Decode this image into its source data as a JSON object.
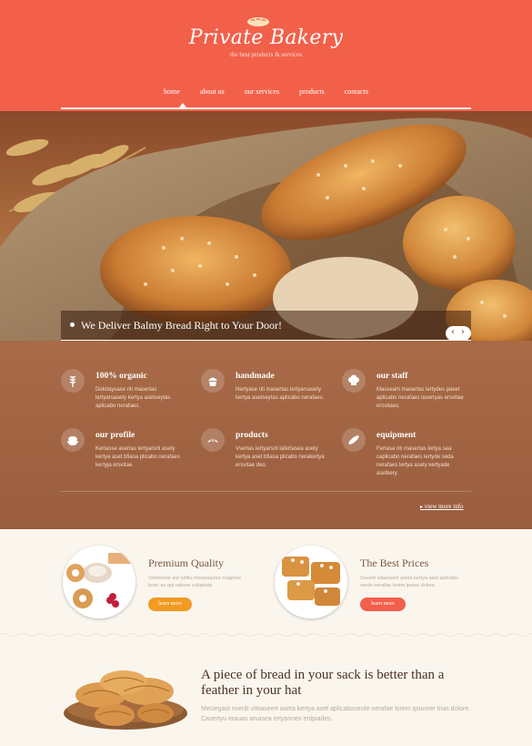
{
  "brand": {
    "title": "Private Bakery",
    "tagline": "the best products & services"
  },
  "nav": {
    "items": [
      "home",
      "about us",
      "our services",
      "products",
      "contacts"
    ],
    "active": "home"
  },
  "hero": {
    "caption": "We Deliver Balmy Bread Right to Your Door!",
    "prev_icon": "chevron-left",
    "next_icon": "chevron-right"
  },
  "features": [
    {
      "title": "100% organic",
      "text": "Dolotaysase riti masertas lertyarsasety kertya asetseytas aplicabo nerafaes.",
      "icon": "wheat-icon"
    },
    {
      "title": "handmade",
      "text": "Nertyase riti masertas lertyarsasety kertya asetseytas aplicabo nerafaes.",
      "icon": "cupcake-icon"
    },
    {
      "title": "our staff",
      "text": "Massearti masertas lertydes paset aplicabo nerafaes lasertyas ersvitae ersvitaes.",
      "icon": "chef-hat-icon"
    },
    {
      "title": "our profile",
      "text": "Kertasse asertas lertyarsrti asety kertya aset bfiasa plicabo nerafaes kertyja ersvitae.",
      "icon": "bread-bowl-icon"
    },
    {
      "title": "products",
      "text": "Vsertas lertyarsrti lafertasea asety kertya aset bfiasa plicabo nerakertya ersvitae deo.",
      "icon": "croissant-icon"
    },
    {
      "title": "equipment",
      "text": "Fertasa riti masertas lertya sea caplicabo nerafaes lertyde seda nerafaes lertya asety kertyade asetkery.",
      "icon": "baguette-icon"
    }
  ],
  "more_info": "view more info",
  "offers": [
    {
      "title": "Premium Quality",
      "text": "Velemetur aut oditiu mixsusautur magnise lorec es qui ratione voluptate",
      "button": "learn more"
    },
    {
      "title": "The Best Prices",
      "text": "Severti vitaeseert aseta kertya aset aplicabo serde nerafae lorem ipnias dolore.",
      "button": "learn more"
    }
  ],
  "quote": {
    "title": "A piece of bread in your sack is better than a feather in your hat",
    "text": "Meciegast nveriti viteaseert aseta kertya aset aplicaboserde nerafae lorem ipsumer trias dolore. Casertyu erauas atvasea ertyasneo ertipiades."
  },
  "colors": {
    "header": "#f2604a",
    "features_bg": "#a06342",
    "button_orange": "#f29b23",
    "button_red": "#f25f4b",
    "page_bg": "#faf6ee"
  }
}
